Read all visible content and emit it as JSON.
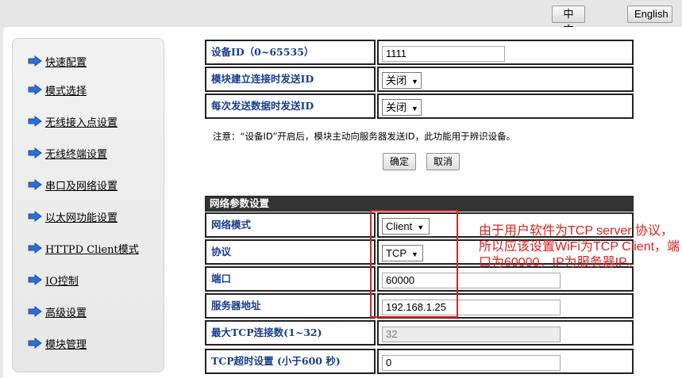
{
  "header": {
    "lang_zh": "中文",
    "lang_en": "English"
  },
  "sidebar": {
    "items": [
      {
        "label": "快速配置"
      },
      {
        "label": "模式选择"
      },
      {
        "label": "无线接入点设置"
      },
      {
        "label": "无线终端设置"
      },
      {
        "label": "串口及网络设置"
      },
      {
        "label": "以太网功能设置"
      },
      {
        "label": "HTTPD Client模式"
      },
      {
        "label": "IO控制"
      },
      {
        "label": "高级设置"
      },
      {
        "label": "模块管理"
      }
    ]
  },
  "device": {
    "id_label": "设备ID（0~65535）",
    "id_value": "1111",
    "connect_label": "模块建立连接时发送ID",
    "connect_value": "关闭",
    "each_label": "每次发送数据时发送ID",
    "each_value": "关闭",
    "note": "注意：“设备ID”开启后，模块主动向服务器发送ID，此功能用于辨识设备。",
    "ok_label": "确定",
    "cancel_label": "取消"
  },
  "network": {
    "section_title": "网络参数设置",
    "mode_label": "网络模式",
    "mode_value": "Client",
    "protocol_label": "协议",
    "protocol_value": "TCP",
    "port_label": "端口",
    "port_value": "60000",
    "server_label": "服务器地址",
    "server_value": "192.168.1.25",
    "maxconn_label": "最大TCP连接数(1~32)",
    "maxconn_value": "32",
    "timeout_label": "TCP超时设置 (小于600 秒)",
    "timeout_value": "0"
  },
  "annotation": {
    "text": "由于用户软件为TCP server 协议，所以应该设置WiFi为TCP Client，端口为60000，IP为服务器IP。",
    "color": "#e02020"
  },
  "colors": {
    "label_text": "#1a3d8c",
    "section_bg": "#333333"
  }
}
